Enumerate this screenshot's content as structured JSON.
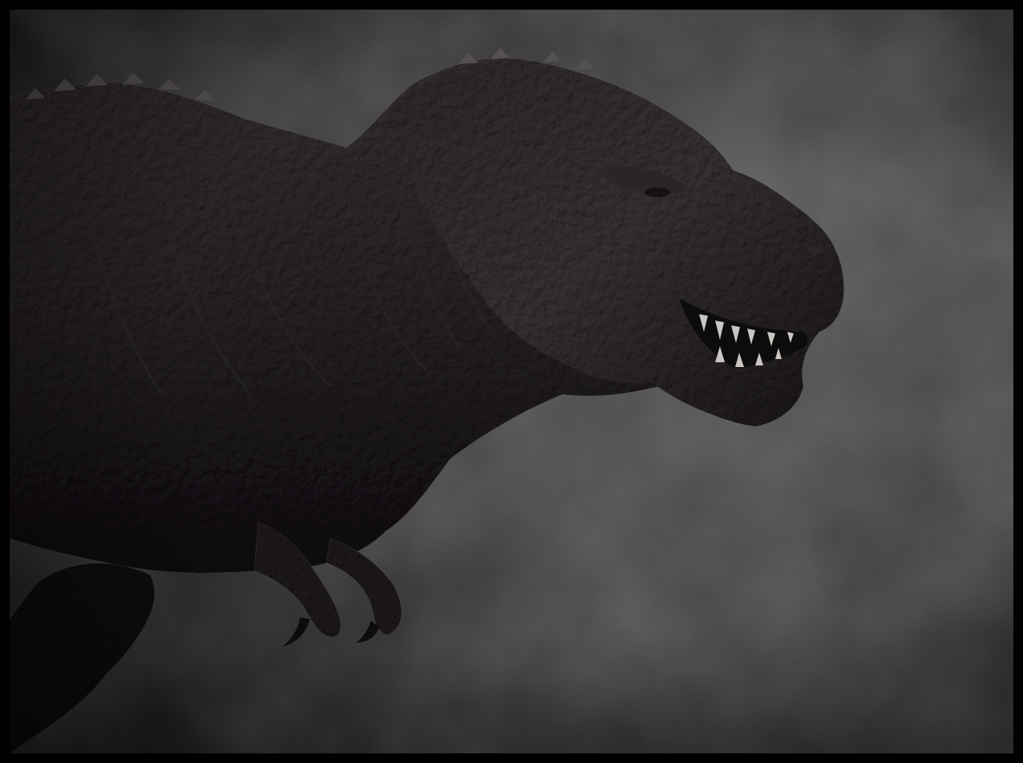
{
  "image": {
    "subject": "tyrannosaurus-rex-sculpt",
    "colors": {
      "frame": "#000000",
      "background_light": "#5a5a5a",
      "background_dark": "#1e1e1e",
      "skin_light": "#6a6468",
      "skin_mid": "#4a4548",
      "skin_dark": "#262325",
      "teeth": "#c9c6c2",
      "mouth": "#0d0c0c"
    }
  }
}
